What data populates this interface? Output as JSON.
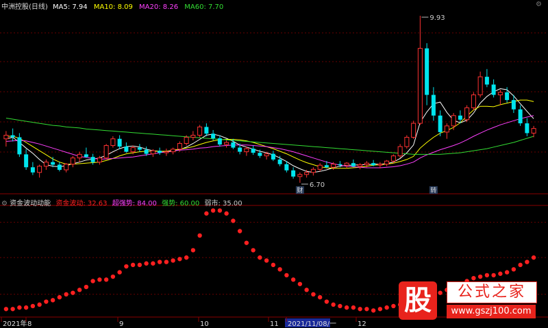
{
  "header_top": {
    "stock": "中洲控股(日线)",
    "ma": [
      {
        "label": "MA5: 7.94",
        "color": "#ffffff"
      },
      {
        "label": "MA10: 8.09",
        "color": "#ffff00"
      },
      {
        "label": "MA20: 8.26",
        "color": "#ff40ff"
      },
      {
        "label": "MA60: 7.70",
        "color": "#33dd33"
      }
    ]
  },
  "header_bottom": {
    "name": "资金波动动能",
    "items": [
      {
        "label": "资金波动: 32.63",
        "color": "#ff2020"
      },
      {
        "label": "超强势: 84.00",
        "color": "#ff40ff"
      },
      {
        "label": "强势: 60.00",
        "color": "#33dd33"
      },
      {
        "label": "弱市: 35.00",
        "color": "#cccccc"
      }
    ]
  },
  "chart_data": [
    {
      "type": "candlestick",
      "price_high_label": "9.93",
      "price_low_label": "6.70",
      "markers": [
        "财",
        "转"
      ],
      "candles": [
        [
          7.55,
          7.7,
          7.4,
          7.62
        ],
        [
          7.62,
          7.75,
          7.5,
          7.58
        ],
        [
          7.58,
          7.66,
          7.2,
          7.25
        ],
        [
          7.25,
          7.35,
          6.95,
          7.0
        ],
        [
          7.0,
          7.1,
          6.85,
          6.9
        ],
        [
          6.9,
          7.05,
          6.8,
          7.02
        ],
        [
          7.02,
          7.15,
          6.95,
          7.1
        ],
        [
          7.1,
          7.2,
          7.0,
          7.05
        ],
        [
          7.05,
          7.1,
          6.92,
          6.95
        ],
        [
          6.95,
          7.08,
          6.9,
          7.06
        ],
        [
          7.06,
          7.22,
          7.0,
          7.18
        ],
        [
          7.18,
          7.3,
          7.1,
          7.25
        ],
        [
          7.25,
          7.38,
          7.18,
          7.2
        ],
        [
          7.2,
          7.26,
          7.05,
          7.1
        ],
        [
          7.1,
          7.22,
          7.05,
          7.18
        ],
        [
          7.18,
          7.45,
          7.15,
          7.42
        ],
        [
          7.42,
          7.6,
          7.38,
          7.55
        ],
        [
          7.55,
          7.62,
          7.35,
          7.4
        ],
        [
          7.4,
          7.48,
          7.28,
          7.3
        ],
        [
          7.3,
          7.42,
          7.25,
          7.38
        ],
        [
          7.38,
          7.45,
          7.3,
          7.34
        ],
        [
          7.34,
          7.4,
          7.22,
          7.26
        ],
        [
          7.26,
          7.35,
          7.2,
          7.32
        ],
        [
          7.32,
          7.38,
          7.24,
          7.28
        ],
        [
          7.28,
          7.36,
          7.22,
          7.3
        ],
        [
          7.3,
          7.38,
          7.25,
          7.35
        ],
        [
          7.35,
          7.5,
          7.3,
          7.46
        ],
        [
          7.46,
          7.62,
          7.42,
          7.58
        ],
        [
          7.58,
          7.7,
          7.52,
          7.62
        ],
        [
          7.62,
          7.82,
          7.58,
          7.78
        ],
        [
          7.78,
          7.85,
          7.6,
          7.65
        ],
        [
          7.65,
          7.72,
          7.52,
          7.56
        ],
        [
          7.56,
          7.62,
          7.4,
          7.44
        ],
        [
          7.44,
          7.52,
          7.38,
          7.48
        ],
        [
          7.48,
          7.55,
          7.35,
          7.38
        ],
        [
          7.38,
          7.46,
          7.25,
          7.3
        ],
        [
          7.3,
          7.4,
          7.22,
          7.36
        ],
        [
          7.36,
          7.42,
          7.24,
          7.28
        ],
        [
          7.28,
          7.34,
          7.18,
          7.22
        ],
        [
          7.22,
          7.3,
          7.15,
          7.26
        ],
        [
          7.26,
          7.32,
          7.12,
          7.15
        ],
        [
          7.15,
          7.22,
          7.02,
          7.06
        ],
        [
          7.06,
          7.12,
          6.9,
          6.94
        ],
        [
          6.94,
          7.0,
          6.78,
          6.82
        ],
        [
          6.82,
          6.9,
          6.7,
          6.86
        ],
        [
          6.86,
          6.95,
          6.8,
          6.9
        ],
        [
          6.9,
          7.0,
          6.84,
          6.96
        ],
        [
          6.96,
          7.08,
          6.92,
          7.04
        ],
        [
          7.04,
          7.12,
          6.98,
          7.0
        ],
        [
          7.0,
          7.1,
          6.95,
          7.06
        ],
        [
          7.06,
          7.12,
          7.0,
          7.04
        ],
        [
          7.04,
          7.1,
          6.98,
          7.08
        ],
        [
          7.08,
          7.15,
          7.0,
          7.02
        ],
        [
          7.02,
          7.08,
          6.96,
          7.05
        ],
        [
          7.05,
          7.12,
          7.0,
          7.08
        ],
        [
          7.08,
          7.14,
          7.02,
          7.04
        ],
        [
          7.04,
          7.1,
          6.98,
          7.06
        ],
        [
          7.06,
          7.14,
          7.02,
          7.12
        ],
        [
          7.12,
          7.25,
          7.08,
          7.22
        ],
        [
          7.22,
          7.45,
          7.18,
          7.4
        ],
        [
          7.4,
          7.62,
          7.36,
          7.58
        ],
        [
          7.58,
          7.9,
          7.55,
          7.85
        ],
        [
          7.85,
          9.93,
          7.82,
          9.3
        ],
        [
          9.3,
          9.4,
          8.2,
          8.4
        ],
        [
          8.4,
          8.55,
          7.9,
          8.0
        ],
        [
          8.0,
          8.1,
          7.6,
          7.68
        ],
        [
          7.68,
          7.85,
          7.55,
          7.8
        ],
        [
          7.8,
          8.05,
          7.72,
          8.0
        ],
        [
          8.0,
          8.1,
          7.85,
          7.92
        ],
        [
          7.92,
          8.2,
          7.88,
          8.15
        ],
        [
          8.15,
          8.45,
          8.1,
          8.4
        ],
        [
          8.4,
          8.85,
          8.35,
          8.75
        ],
        [
          8.75,
          8.9,
          8.55,
          8.6
        ],
        [
          8.6,
          8.7,
          8.35,
          8.4
        ],
        [
          8.4,
          8.5,
          8.2,
          8.45
        ],
        [
          8.45,
          8.55,
          8.25,
          8.3
        ],
        [
          8.3,
          8.4,
          8.05,
          8.12
        ],
        [
          8.12,
          8.2,
          7.8,
          7.85
        ],
        [
          7.85,
          7.95,
          7.6,
          7.66
        ],
        [
          7.66,
          7.8,
          7.58,
          7.75
        ]
      ],
      "ma": [
        {
          "name": "MA5",
          "color": "#ffffff",
          "values": [
            7.55,
            7.58,
            7.48,
            7.37,
            7.27,
            7.15,
            7.05,
            7.02,
            7.01,
            7.03,
            7.07,
            7.1,
            7.14,
            7.16,
            7.18,
            7.23,
            7.3,
            7.36,
            7.4,
            7.41,
            7.39,
            7.35,
            7.32,
            7.31,
            7.3,
            7.31,
            7.34,
            7.39,
            7.46,
            7.54,
            7.62,
            7.64,
            7.61,
            7.56,
            7.5,
            7.43,
            7.39,
            7.35,
            7.31,
            7.28,
            7.24,
            7.18,
            7.11,
            7.03,
            6.97,
            6.92,
            6.9,
            6.92,
            6.95,
            6.99,
            7.02,
            7.04,
            7.04,
            7.05,
            7.05,
            7.06,
            7.06,
            7.07,
            7.1,
            7.17,
            7.28,
            7.43,
            7.87,
            8.07,
            8.23,
            8.26,
            8.06,
            7.91,
            7.86,
            7.91,
            8.05,
            8.24,
            8.37,
            8.46,
            8.52,
            8.5,
            8.38,
            8.23,
            8.08,
            7.94
          ]
        },
        {
          "name": "MA10",
          "color": "#ffff00",
          "values": [
            7.6,
            7.6,
            7.56,
            7.48,
            7.4,
            7.32,
            7.24,
            7.16,
            7.1,
            7.06,
            7.06,
            7.07,
            7.08,
            7.09,
            7.1,
            7.13,
            7.17,
            7.22,
            7.26,
            7.28,
            7.3,
            7.31,
            7.31,
            7.31,
            7.31,
            7.33,
            7.35,
            7.37,
            7.4,
            7.44,
            7.48,
            7.51,
            7.53,
            7.54,
            7.54,
            7.53,
            7.51,
            7.48,
            7.44,
            7.4,
            7.36,
            7.31,
            7.26,
            7.2,
            7.14,
            7.09,
            7.05,
            7.01,
            6.99,
            6.98,
            6.98,
            6.98,
            6.99,
            7.0,
            7.02,
            7.04,
            7.05,
            7.06,
            7.08,
            7.11,
            7.15,
            7.21,
            7.37,
            7.48,
            7.58,
            7.66,
            7.71,
            7.77,
            7.86,
            7.99,
            8.11,
            8.18,
            8.18,
            8.17,
            8.21,
            8.24,
            8.27,
            8.3,
            8.3,
            8.27
          ]
        },
        {
          "name": "MA20",
          "color": "#ff40ff",
          "values": [
            7.5,
            7.51,
            7.52,
            7.51,
            7.48,
            7.45,
            7.41,
            7.37,
            7.33,
            7.29,
            7.25,
            7.21,
            7.19,
            7.17,
            7.16,
            7.16,
            7.17,
            7.18,
            7.19,
            7.2,
            7.22,
            7.24,
            7.26,
            7.28,
            7.3,
            7.32,
            7.33,
            7.34,
            7.35,
            7.37,
            7.38,
            7.4,
            7.41,
            7.42,
            7.43,
            7.43,
            7.43,
            7.42,
            7.41,
            7.4,
            7.38,
            7.36,
            7.33,
            7.3,
            7.26,
            7.22,
            7.18,
            7.14,
            7.1,
            7.07,
            7.04,
            7.02,
            7.01,
            7.0,
            6.99,
            6.99,
            6.99,
            7.0,
            7.01,
            7.03,
            7.06,
            7.1,
            7.18,
            7.24,
            7.29,
            7.34,
            7.38,
            7.42,
            7.47,
            7.53,
            7.6,
            7.66,
            7.72,
            7.77,
            7.82,
            7.86,
            7.9,
            7.94,
            7.97,
            8.0
          ]
        },
        {
          "name": "MA60",
          "color": "#33dd33",
          "values": [
            7.95,
            7.93,
            7.91,
            7.89,
            7.87,
            7.85,
            7.83,
            7.81,
            7.8,
            7.78,
            7.77,
            7.76,
            7.74,
            7.73,
            7.72,
            7.71,
            7.7,
            7.69,
            7.68,
            7.67,
            7.66,
            7.65,
            7.64,
            7.63,
            7.62,
            7.61,
            7.6,
            7.59,
            7.58,
            7.57,
            7.56,
            7.55,
            7.54,
            7.53,
            7.52,
            7.51,
            7.5,
            7.49,
            7.48,
            7.47,
            7.46,
            7.45,
            7.44,
            7.43,
            7.42,
            7.41,
            7.4,
            7.39,
            7.38,
            7.37,
            7.36,
            7.35,
            7.34,
            7.33,
            7.32,
            7.31,
            7.3,
            7.29,
            7.28,
            7.27,
            7.26,
            7.25,
            7.25,
            7.25,
            7.25,
            7.25,
            7.26,
            7.27,
            7.28,
            7.3,
            7.32,
            7.34,
            7.36,
            7.39,
            7.42,
            7.45,
            7.48,
            7.52,
            7.56,
            7.6
          ]
        }
      ]
    },
    {
      "type": "scatter",
      "series": [
        {
          "name": "资金波动",
          "color": "#ff2020",
          "values": [
            25,
            25,
            26,
            26,
            27,
            28,
            30,
            31,
            33,
            35,
            36,
            38,
            40,
            44,
            45,
            45,
            47,
            50,
            54,
            55,
            55,
            56,
            56,
            57,
            57,
            58,
            59,
            60,
            65,
            75,
            90,
            92,
            92,
            90,
            85,
            78,
            70,
            65,
            60,
            58,
            55,
            52,
            48,
            45,
            42,
            38,
            35,
            33,
            30,
            28,
            27,
            26,
            26,
            25,
            25,
            24,
            25,
            26,
            27,
            28,
            29,
            30,
            31,
            33,
            35,
            36,
            38,
            40,
            42,
            44,
            46,
            47,
            48,
            48,
            49,
            50,
            52,
            55,
            57,
            60
          ]
        }
      ],
      "levels": [
        {
          "name": "超强势",
          "value": 84
        },
        {
          "name": "强势",
          "value": 60
        },
        {
          "name": "弱市",
          "value": 35
        }
      ],
      "xaxis_labels": [
        "2021年",
        "8",
        "9",
        "10",
        "11",
        "2021/11/08/一",
        "12"
      ]
    }
  ],
  "watermark": {
    "badge": "股",
    "title": "公式之家",
    "url": "www.gszj100.com"
  }
}
